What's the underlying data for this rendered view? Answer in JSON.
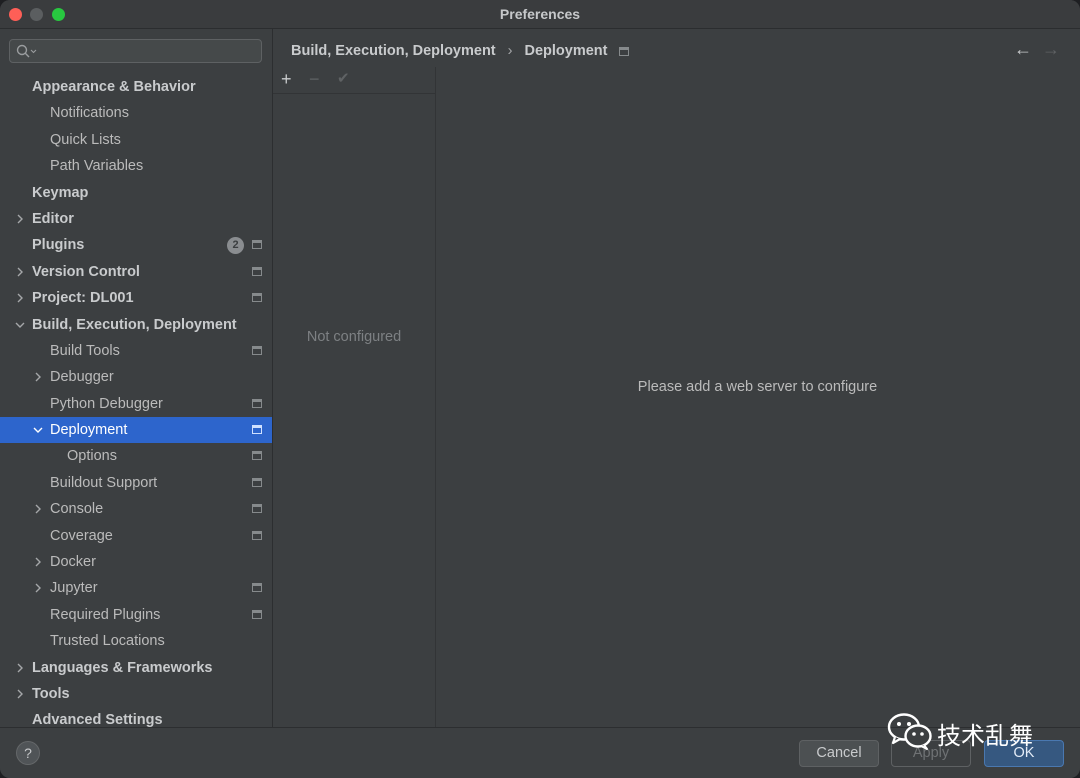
{
  "window": {
    "title": "Preferences"
  },
  "sidebar": {
    "search_placeholder": "",
    "items": [
      {
        "label": "Appearance & Behavior",
        "bold": true,
        "level": 0,
        "arrow": "",
        "settings_icon": false,
        "badge": ""
      },
      {
        "label": "Notifications",
        "bold": false,
        "level": 1,
        "arrow": "",
        "settings_icon": false,
        "badge": ""
      },
      {
        "label": "Quick Lists",
        "bold": false,
        "level": 1,
        "arrow": "",
        "settings_icon": false,
        "badge": ""
      },
      {
        "label": "Path Variables",
        "bold": false,
        "level": 1,
        "arrow": "",
        "settings_icon": false,
        "badge": ""
      },
      {
        "label": "Keymap",
        "bold": true,
        "level": 0,
        "arrow": "",
        "settings_icon": false,
        "badge": ""
      },
      {
        "label": "Editor",
        "bold": true,
        "level": 0,
        "arrow": "collapsed",
        "settings_icon": false,
        "badge": ""
      },
      {
        "label": "Plugins",
        "bold": true,
        "level": 0,
        "arrow": "",
        "settings_icon": true,
        "badge": "2"
      },
      {
        "label": "Version Control",
        "bold": true,
        "level": 0,
        "arrow": "collapsed",
        "settings_icon": true,
        "badge": ""
      },
      {
        "label": "Project: DL001",
        "bold": true,
        "level": 0,
        "arrow": "collapsed",
        "settings_icon": true,
        "badge": ""
      },
      {
        "label": "Build, Execution, Deployment",
        "bold": true,
        "level": 0,
        "arrow": "expanded",
        "settings_icon": false,
        "badge": ""
      },
      {
        "label": "Build Tools",
        "bold": false,
        "level": 1,
        "arrow": "",
        "settings_icon": true,
        "badge": ""
      },
      {
        "label": "Debugger",
        "bold": false,
        "level": 1,
        "arrow": "collapsed",
        "settings_icon": false,
        "badge": ""
      },
      {
        "label": "Python Debugger",
        "bold": false,
        "level": 1,
        "arrow": "",
        "settings_icon": true,
        "badge": ""
      },
      {
        "label": "Deployment",
        "bold": false,
        "level": 1,
        "arrow": "expanded",
        "settings_icon": true,
        "badge": "",
        "selected": true
      },
      {
        "label": "Options",
        "bold": false,
        "level": 2,
        "arrow": "",
        "settings_icon": true,
        "badge": ""
      },
      {
        "label": "Buildout Support",
        "bold": false,
        "level": 1,
        "arrow": "",
        "settings_icon": true,
        "badge": ""
      },
      {
        "label": "Console",
        "bold": false,
        "level": 1,
        "arrow": "collapsed",
        "settings_icon": true,
        "badge": ""
      },
      {
        "label": "Coverage",
        "bold": false,
        "level": 1,
        "arrow": "",
        "settings_icon": true,
        "badge": ""
      },
      {
        "label": "Docker",
        "bold": false,
        "level": 1,
        "arrow": "collapsed",
        "settings_icon": false,
        "badge": ""
      },
      {
        "label": "Jupyter",
        "bold": false,
        "level": 1,
        "arrow": "collapsed",
        "settings_icon": true,
        "badge": ""
      },
      {
        "label": "Required Plugins",
        "bold": false,
        "level": 1,
        "arrow": "",
        "settings_icon": true,
        "badge": ""
      },
      {
        "label": "Trusted Locations",
        "bold": false,
        "level": 1,
        "arrow": "",
        "settings_icon": false,
        "badge": ""
      },
      {
        "label": "Languages & Frameworks",
        "bold": true,
        "level": 0,
        "arrow": "collapsed",
        "settings_icon": false,
        "badge": ""
      },
      {
        "label": "Tools",
        "bold": true,
        "level": 0,
        "arrow": "collapsed",
        "settings_icon": false,
        "badge": ""
      },
      {
        "label": "Advanced Settings",
        "bold": true,
        "level": 0,
        "arrow": "",
        "settings_icon": false,
        "badge": ""
      }
    ]
  },
  "main": {
    "breadcrumb": [
      "Build, Execution, Deployment",
      "Deployment"
    ],
    "breadcrumb_separator": "›",
    "nav_back": "←",
    "nav_forward": "→",
    "toolbar": {
      "add": "+",
      "remove": "−",
      "apply": "✔"
    },
    "list_empty_text": "Not configured",
    "placeholder_text": "Please add a web server to configure"
  },
  "footer": {
    "help_label": "?",
    "cancel_label": "Cancel",
    "apply_label": "Apply",
    "ok_label": "OK"
  },
  "watermark": {
    "text": "技术乱舞"
  },
  "colors": {
    "selection": "#2d65cc",
    "ok_button": "#365880",
    "background": "#3c3f41"
  }
}
